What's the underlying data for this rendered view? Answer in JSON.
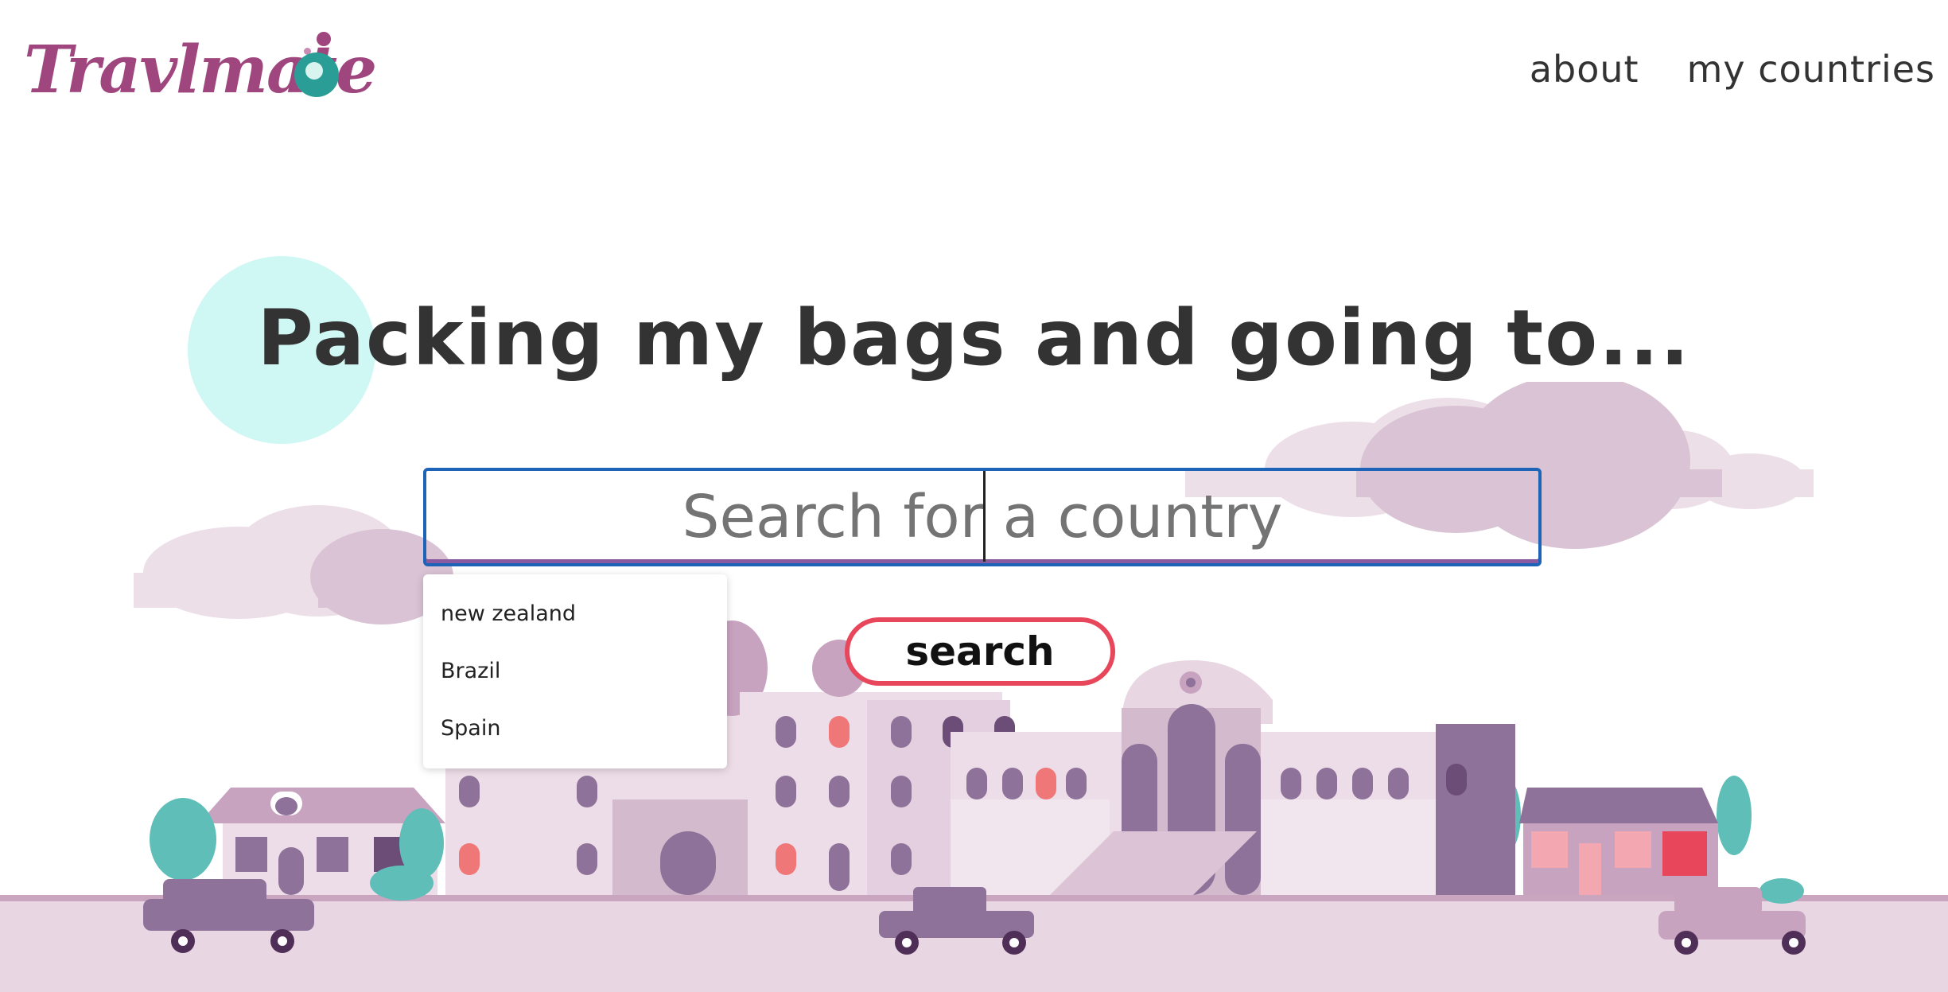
{
  "header": {
    "logo_text": "Travlmate",
    "nav": [
      {
        "label": "about"
      },
      {
        "label": "my countries"
      }
    ]
  },
  "hero": {
    "headline": "Packing my bags and going to..."
  },
  "search": {
    "placeholder": "Search for a country",
    "value": "",
    "suggestions": [
      "new zealand",
      "Brazil",
      "Spain"
    ],
    "button_label": "search"
  },
  "colors": {
    "brand": "#a0467e",
    "accent": "#e8475b",
    "focus": "#1d63b8",
    "teal": "#2a9d96",
    "circle": "#cff7f4",
    "ground": "#e8d6e3"
  }
}
